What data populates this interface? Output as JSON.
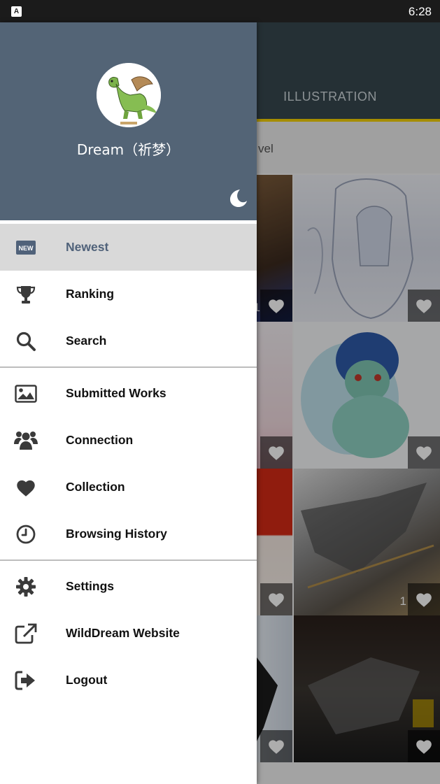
{
  "status_bar": {
    "app_badge": "A",
    "time": "6:28"
  },
  "background": {
    "tab_label": "ILLUSTRATION",
    "filter_fragment": "vel",
    "tile_counts": [
      "1",
      "",
      "",
      "",
      "1",
      "",
      "",
      ""
    ]
  },
  "drawer": {
    "username": "Dream（祈梦）",
    "menu_groups": [
      [
        {
          "label": "Newest",
          "icon": "new-icon",
          "active": true
        },
        {
          "label": "Ranking",
          "icon": "trophy-icon",
          "active": false
        },
        {
          "label": "Search",
          "icon": "search-icon",
          "active": false
        }
      ],
      [
        {
          "label": "Submitted Works",
          "icon": "image-icon",
          "active": false
        },
        {
          "label": "Connection",
          "icon": "users-icon",
          "active": false
        },
        {
          "label": "Collection",
          "icon": "heart-icon",
          "active": false
        },
        {
          "label": "Browsing History",
          "icon": "clock-icon",
          "active": false
        }
      ],
      [
        {
          "label": "Settings",
          "icon": "gear-icon",
          "active": false
        },
        {
          "label": "WildDream Website",
          "icon": "external-link-icon",
          "active": false
        },
        {
          "label": "Logout",
          "icon": "logout-icon",
          "active": false
        }
      ]
    ]
  },
  "colors": {
    "header": "#536476",
    "active_label": "#50627a",
    "active_bg": "#d9d9d9",
    "icon": "#3a3a3a",
    "tab_indicator": "#f5d000"
  }
}
